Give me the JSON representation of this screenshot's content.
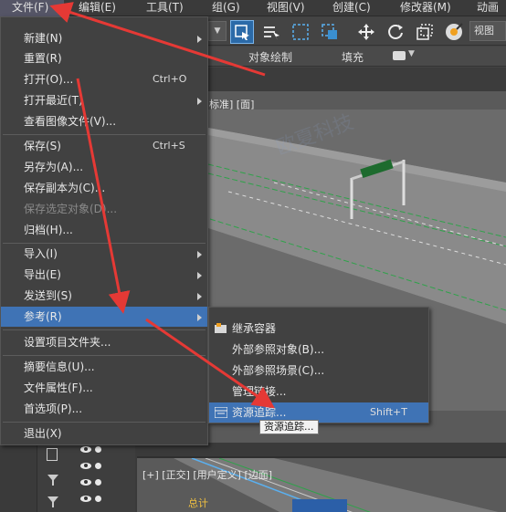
{
  "menubar": {
    "items": [
      {
        "label": "文件(F)"
      },
      {
        "label": "编辑(E)"
      },
      {
        "label": "工具(T)"
      },
      {
        "label": "组(G)"
      },
      {
        "label": "视图(V)"
      },
      {
        "label": "创建(C)"
      },
      {
        "label": "修改器(M)"
      },
      {
        "label": "动画"
      }
    ]
  },
  "toolbar": {
    "view_label": "视图"
  },
  "ribbon": {
    "object_paint": "对象绘制",
    "fill": "填充"
  },
  "viewport": {
    "top_label": "标准] [面]",
    "lower_label": "[+] [正交] [用户定义] [边面]",
    "lower_text": "总计"
  },
  "file_menu": {
    "items": [
      {
        "label": "新建(N)",
        "shortcut": "",
        "submenu": true,
        "disabled": false
      },
      {
        "label": "重置(R)",
        "shortcut": "",
        "submenu": false,
        "disabled": false
      },
      {
        "label": "打开(O)...",
        "shortcut": "Ctrl+O",
        "submenu": false,
        "disabled": false
      },
      {
        "label": "打开最近(T)",
        "shortcut": "",
        "submenu": true,
        "disabled": false
      },
      {
        "label": "查看图像文件(V)...",
        "shortcut": "",
        "submenu": false,
        "disabled": false
      },
      {
        "label": "保存(S)",
        "shortcut": "Ctrl+S",
        "submenu": false,
        "disabled": false
      },
      {
        "label": "另存为(A)...",
        "shortcut": "",
        "submenu": false,
        "disabled": false
      },
      {
        "label": "保存副本为(C)...",
        "shortcut": "",
        "submenu": false,
        "disabled": false
      },
      {
        "label": "保存选定对象(D)...",
        "shortcut": "",
        "submenu": false,
        "disabled": true
      },
      {
        "label": "归档(H)...",
        "shortcut": "",
        "submenu": false,
        "disabled": false
      },
      {
        "label": "导入(I)",
        "shortcut": "",
        "submenu": true,
        "disabled": false
      },
      {
        "label": "导出(E)",
        "shortcut": "",
        "submenu": true,
        "disabled": false
      },
      {
        "label": "发送到(S)",
        "shortcut": "",
        "submenu": true,
        "disabled": false
      },
      {
        "label": "参考(R)",
        "shortcut": "",
        "submenu": true,
        "disabled": false
      },
      {
        "label": "设置项目文件夹...",
        "shortcut": "",
        "submenu": false,
        "disabled": false
      },
      {
        "label": "摘要信息(U)...",
        "shortcut": "",
        "submenu": false,
        "disabled": false
      },
      {
        "label": "文件属性(F)...",
        "shortcut": "",
        "submenu": false,
        "disabled": false
      },
      {
        "label": "首选项(P)...",
        "shortcut": "",
        "submenu": false,
        "disabled": false
      },
      {
        "label": "退出(X)",
        "shortcut": "",
        "submenu": false,
        "disabled": false
      }
    ]
  },
  "reference_submenu": {
    "items": [
      {
        "label": "继承容器",
        "shortcut": "",
        "icon": "inherit-container-icon"
      },
      {
        "label": "外部参照对象(B)...",
        "shortcut": "",
        "icon": ""
      },
      {
        "label": "外部参照场景(C)...",
        "shortcut": "",
        "icon": ""
      },
      {
        "label": "管理链接...",
        "shortcut": "",
        "icon": ""
      },
      {
        "label": "资源追踪...",
        "shortcut": "Shift+T",
        "icon": "asset-tracking-icon"
      }
    ]
  },
  "tooltip": {
    "text": "资源追踪..."
  },
  "watermark": {
    "text": "火星时代 / 欧夏科技"
  },
  "colors": {
    "highlight": "#3f73b5",
    "arrow": "#e53935",
    "menu_bg": "#414141"
  }
}
